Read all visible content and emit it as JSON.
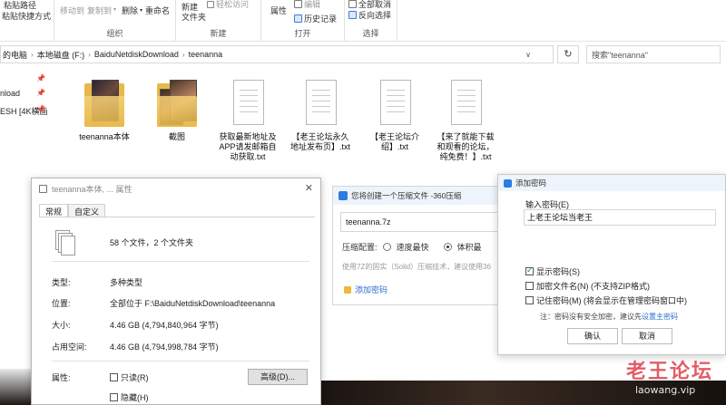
{
  "ribbon": {
    "clipboard": {
      "paste_shortcut": "粘贴快捷方式",
      "top_clip": "粘贴路径"
    },
    "organize": {
      "move_to": "移动到",
      "copy_to": "复制到",
      "delete": "删除",
      "rename": "重命名",
      "label": "组织"
    },
    "new": {
      "new_folder": "新建\n文件夹",
      "easy_access": "轻松访问",
      "label": "新建"
    },
    "open": {
      "properties": "属性",
      "edit": "编辑",
      "history": "历史记录",
      "label": "打开"
    },
    "select": {
      "select_none": "全部取消",
      "invert": "反向选择",
      "label": "选择"
    }
  },
  "address": {
    "crumbs": [
      "的电脑",
      "本地磁盘 (F:)",
      "BaiduNetdiskDownload",
      "teenanna"
    ],
    "search_placeholder": "搜索\"teenanna\""
  },
  "nav": {
    "items": [
      "nload",
      "ESH [4K横画"
    ]
  },
  "files": [
    {
      "name": "teenanna本体",
      "kind": "folder"
    },
    {
      "name": "截图",
      "kind": "folder"
    },
    {
      "name": "获取最新地址及APP请发邮箱自动获取.txt",
      "kind": "txt"
    },
    {
      "name": "【老王论坛永久地址发布页】.txt",
      "kind": "txt"
    },
    {
      "name": "【老王论坛介绍】.txt",
      "kind": "txt"
    },
    {
      "name": "【来了就能下载和观看的论坛，纯免费！】.txt",
      "kind": "txt"
    }
  ],
  "properties": {
    "title": "teenanna本体, ... 属性",
    "tabs": [
      "常规",
      "自定义"
    ],
    "count": "58 个文件，2 个文件夹",
    "rows": [
      {
        "label": "类型:",
        "value": "多种类型"
      },
      {
        "label": "位置:",
        "value": "全部位于 F:\\BaiduNetdiskDownload\\teenanna"
      },
      {
        "label": "大小:",
        "value": "4.46 GB (4,794,840,964 字节)"
      },
      {
        "label": "占用空间:",
        "value": "4.46 GB (4,794,998,784 字节)"
      }
    ],
    "attr_label": "属性:",
    "readonly": "只读(R)",
    "hidden": "隐藏(H)",
    "advanced": "高级(D)..."
  },
  "zip": {
    "header": "您将创建一个压缩文件 -360压缩",
    "filename": "teenanna.7z",
    "config_label": "压缩配置:",
    "opt_fast": "速度最快",
    "opt_small": "体积最",
    "hint": "使用7Z的固实（Solid）压缩技术，建议使用36",
    "add_password": "添加密码"
  },
  "password": {
    "header": "添加密码",
    "input_label": "输入密码(E)",
    "input_value": "上老王论坛当老王",
    "show_password": "显示密码(S)",
    "encrypt_names": "加密文件名(N) (不支持ZIP格式)",
    "remember": "记住密码(M) (将会显示在管理密码窗口中)",
    "note_prefix": "注：密码没有安全加密，建议先",
    "note_link": "设置主密码",
    "ok": "确认",
    "cancel": "取消"
  },
  "watermark": {
    "title": "老王论坛",
    "url": "laowang.vip"
  }
}
